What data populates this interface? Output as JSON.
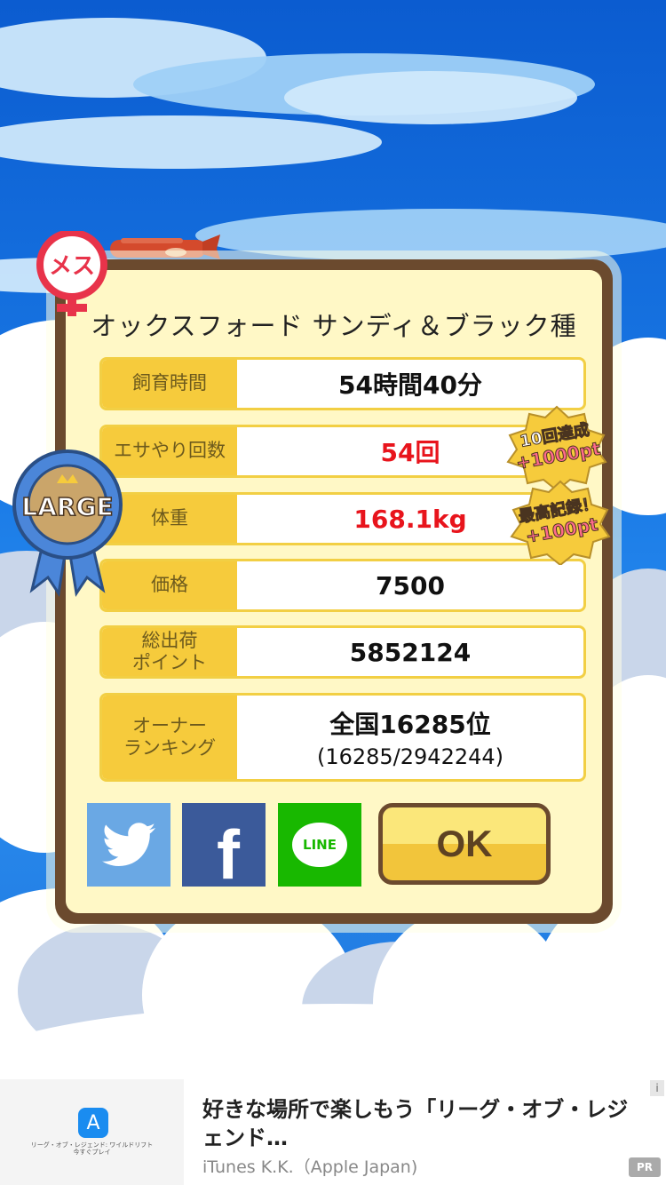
{
  "dialog": {
    "title": "オックスフォード サンディ＆ブラック種",
    "rows": [
      {
        "label": "飼育時間",
        "value": "54時間40分"
      },
      {
        "label": "エサやり回数",
        "value": "54回"
      },
      {
        "label": "体重",
        "value": "168.1kg"
      },
      {
        "label": "価格",
        "value": "7500"
      },
      {
        "label": "総出荷\nポイント",
        "value": "5852124"
      },
      {
        "label": "オーナー\nランキング",
        "value": "全国16285位",
        "sub": "(16285/2942244)"
      }
    ],
    "ok_label": "OK",
    "line_label": "LINE",
    "facebook_glyph": "f"
  },
  "badges": {
    "female": "メス",
    "size": "LARGE",
    "bonus1_line1": "10回達成",
    "bonus1_line2": "+1000pt",
    "bonus2_line1": "最高記録！",
    "bonus2_line2": "+100pt"
  },
  "ad": {
    "title": "好きな場所で楽しもう「リーグ・オブ・レジェンド…",
    "advertiser": "iTunes K.K.（Apple Japan)",
    "mini_line1": "リーグ・オブ・レジェンド: ワイルドリフト",
    "mini_line2": "今すぐプレイ",
    "info": "i",
    "pr": "PR"
  },
  "colors": {
    "label_bg": "#f6cb3c",
    "highlight_red": "#e8141c",
    "frame_brown": "#6b4a2e",
    "panel_cream": "#fff8c6"
  }
}
